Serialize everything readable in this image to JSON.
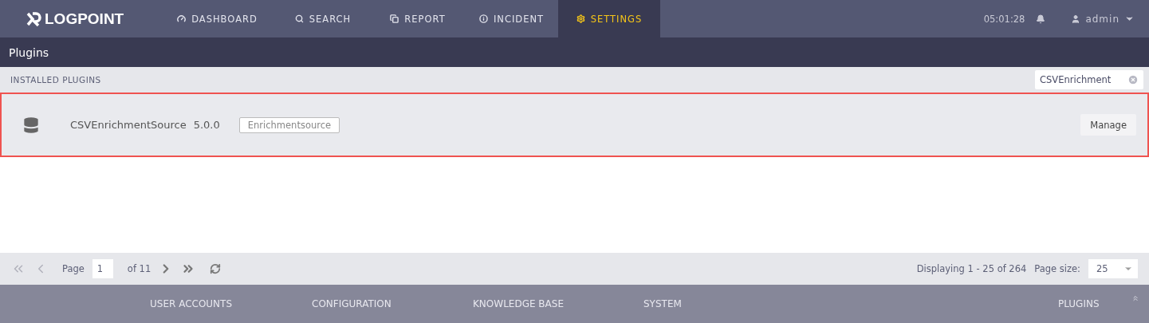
{
  "header": {
    "logo": "LOGPOINT",
    "nav": [
      {
        "label": "DASHBOARD",
        "kind": "gauge",
        "selected": false
      },
      {
        "label": "SEARCH",
        "kind": "search",
        "selected": false
      },
      {
        "label": "REPORT",
        "kind": "report",
        "selected": false
      },
      {
        "label": "INCIDENT",
        "kind": "info",
        "selected": false
      },
      {
        "label": "SETTINGS",
        "kind": "gear",
        "selected": true
      }
    ],
    "time": "05:01:28",
    "user": "admin"
  },
  "page_title": "Plugins",
  "section": {
    "title": "INSTALLED PLUGINS",
    "search": {
      "value": "CSVEnrichment"
    }
  },
  "plugins": [
    {
      "name": "CSVEnrichmentSource",
      "version": "5.0.0",
      "tag": "Enrichmentsource",
      "action": "Manage",
      "highlighted": true
    }
  ],
  "pagination": {
    "page_label": "Page",
    "page": "1",
    "of": "of 11",
    "displaying": "Displaying 1 - 25 of 264",
    "page_size_label": "Page size:",
    "page_size": "25"
  },
  "footer_nav": [
    {
      "label": "USER ACCOUNTS"
    },
    {
      "label": "CONFIGURATION"
    },
    {
      "label": "KNOWLEDGE BASE"
    },
    {
      "label": "SYSTEM"
    },
    {
      "label": "PLUGINS"
    }
  ]
}
